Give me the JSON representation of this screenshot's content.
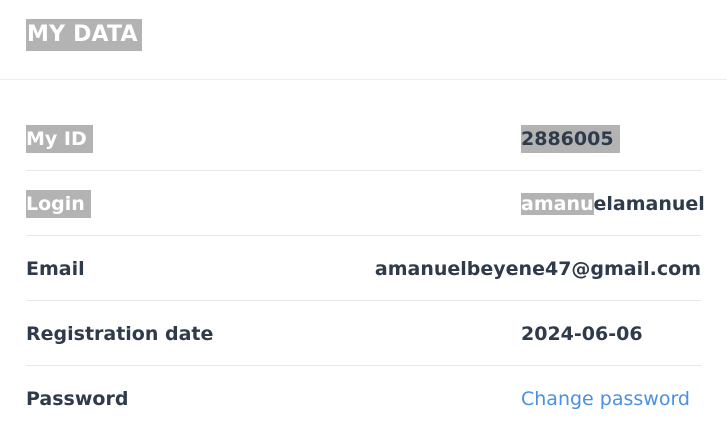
{
  "header": {
    "title": "MY DATA"
  },
  "rows": [
    {
      "label": "My ID",
      "value": "2886005"
    },
    {
      "label": "Login",
      "value_highlight": "amanu",
      "value_rest": "elamanuel"
    },
    {
      "label": "Email",
      "value": "amanuelbeyene47@gmail.com"
    },
    {
      "label": "Registration date",
      "value": "2024-06-06"
    },
    {
      "label": "Password",
      "value": "Change password"
    }
  ],
  "colors": {
    "highlight": "#b3b3b3",
    "link": "#4a90e2",
    "text": "#2f3a4a"
  }
}
